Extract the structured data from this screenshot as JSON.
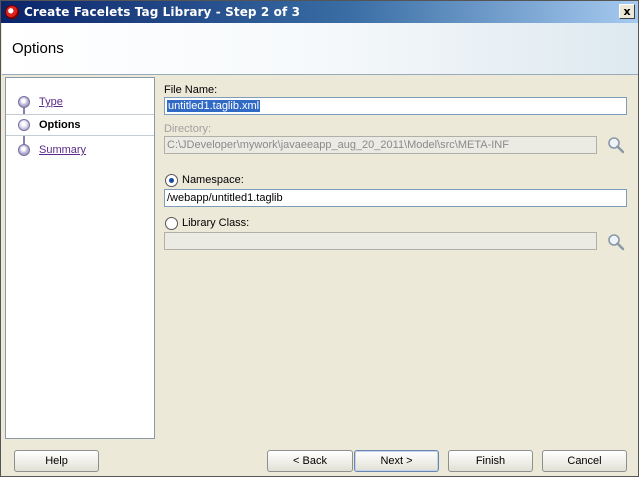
{
  "window": {
    "title": "Create Facelets Tag Library - Step 2 of 3",
    "close_label": "x"
  },
  "header": {
    "title": "Options"
  },
  "nav": {
    "items": [
      {
        "label": "Type",
        "current": false
      },
      {
        "label": "Options",
        "current": true
      },
      {
        "label": "Summary",
        "current": false
      }
    ]
  },
  "form": {
    "file_name": {
      "label": "File Name:",
      "value": "untitled1.taglib.xml"
    },
    "directory": {
      "label": "Directory:",
      "value": "C:\\JDeveloper\\mywork\\javaeeapp_aug_20_2011\\Model\\src\\META-INF"
    },
    "namespace": {
      "label": "Namespace:",
      "value": "/webapp/untitled1.taglib",
      "selected": true
    },
    "library_class": {
      "label": "Library Class:",
      "value": "",
      "selected": false
    }
  },
  "buttons": {
    "help": "Help",
    "back": "< Back",
    "next": "Next >",
    "finish": "Finish",
    "cancel": "Cancel"
  }
}
